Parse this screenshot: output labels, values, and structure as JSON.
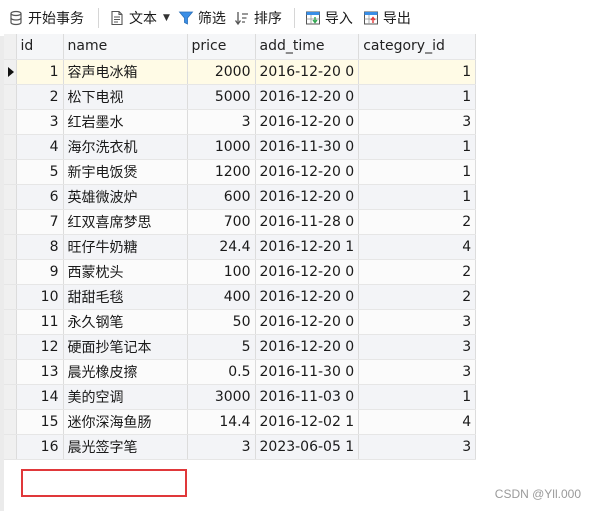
{
  "toolbar": {
    "begin_transaction": "开始事务",
    "text": "文本",
    "filter": "筛选",
    "sort": "排序",
    "import": "导入",
    "export": "导出"
  },
  "columns": [
    "id",
    "name",
    "price",
    "add_time",
    "category_id"
  ],
  "rows": [
    [
      "1",
      "容声电冰箱",
      "2000",
      "2016-12-20 0",
      "1"
    ],
    [
      "2",
      "松下电视",
      "5000",
      "2016-12-20 0",
      "1"
    ],
    [
      "3",
      "红岩墨水",
      "3",
      "2016-12-20 0",
      "3"
    ],
    [
      "4",
      "海尔洗衣机",
      "1000",
      "2016-11-30 0",
      "1"
    ],
    [
      "5",
      "新宇电饭煲",
      "1200",
      "2016-12-20 0",
      "1"
    ],
    [
      "6",
      "英雄微波炉",
      "600",
      "2016-12-20 0",
      "1"
    ],
    [
      "7",
      "红双喜席梦思",
      "700",
      "2016-11-28 0",
      "2"
    ],
    [
      "8",
      "旺仔牛奶糖",
      "24.4",
      "2016-12-20 1",
      "4"
    ],
    [
      "9",
      "西蒙枕头",
      "100",
      "2016-12-20 0",
      "2"
    ],
    [
      "10",
      "甜甜毛毯",
      "400",
      "2016-12-20 0",
      "2"
    ],
    [
      "11",
      "永久钢笔",
      "50",
      "2016-12-20 0",
      "3"
    ],
    [
      "12",
      "硬面抄笔记本",
      "5",
      "2016-12-20 0",
      "3"
    ],
    [
      "13",
      "晨光橡皮擦",
      "0.5",
      "2016-11-30 0",
      "3"
    ],
    [
      "14",
      "美的空调",
      "3000",
      "2016-11-03 0",
      "1"
    ],
    [
      "15",
      "迷你深海鱼肠",
      "14.4",
      "2016-12-02 1",
      "4"
    ],
    [
      "16",
      "晨光签字笔",
      "3",
      "2023-06-05 1",
      "3"
    ]
  ],
  "selected_row_index": 0,
  "highlighted_row_index": 15,
  "colors": {
    "highlight_border": "#e0383a",
    "header_bg": "#f5f6f8",
    "row_alt_bg": "#f3f4f7"
  },
  "watermark": "CSDN @Yll.000"
}
